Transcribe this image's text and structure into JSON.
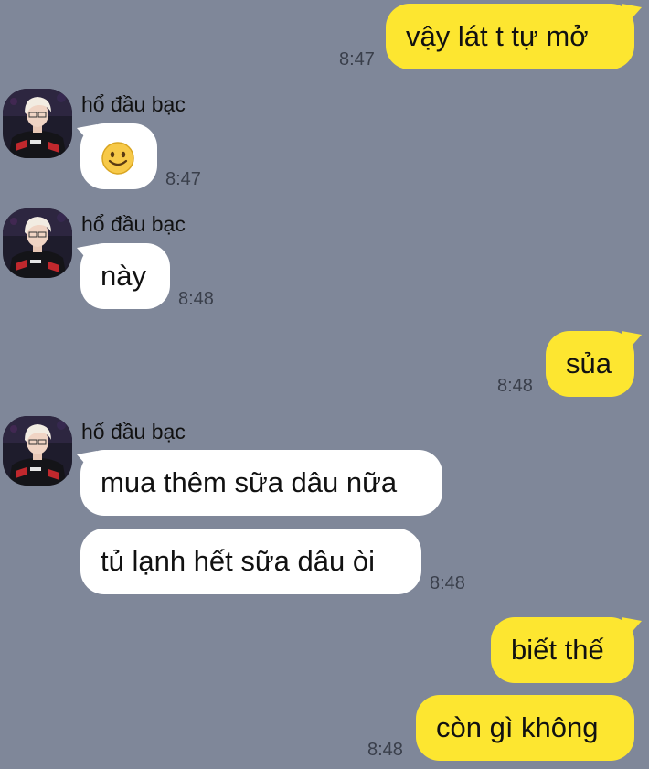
{
  "chat": {
    "contact_name": "hổ đầu bạc",
    "emoji_smile": "🙂",
    "messages": [
      {
        "direction": "out",
        "text": "vậy lát t tự mở",
        "time": "8:47"
      },
      {
        "direction": "in",
        "sender": "hổ đầu bạc",
        "content": "smile-emoji",
        "time": "8:47"
      },
      {
        "direction": "in",
        "sender": "hổ đầu bạc",
        "text": "này",
        "time": "8:48"
      },
      {
        "direction": "out",
        "text": "sủa",
        "time": "8:48"
      },
      {
        "direction": "in",
        "sender": "hổ đầu bạc",
        "text": "mua thêm sữa dâu nữa"
      },
      {
        "direction": "in",
        "text": "tủ lạnh hết sữa dâu òi",
        "time": "8:48"
      },
      {
        "direction": "out",
        "text": "biết thế"
      },
      {
        "direction": "out",
        "text": "còn gì không",
        "time": "8:48"
      }
    ]
  },
  "colors": {
    "background": "#7f8799",
    "incoming_bubble": "#ffffff",
    "outgoing_bubble": "#fde630",
    "timestamp": "#3a3f4b"
  }
}
